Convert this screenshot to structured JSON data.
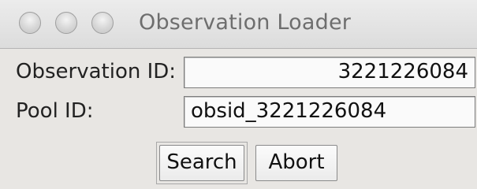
{
  "window": {
    "title": "Observation Loader"
  },
  "form": {
    "observation_id": {
      "label": "Observation ID:",
      "value": "3221226084"
    },
    "pool_id": {
      "label": "Pool ID:",
      "value": "obsid_3221226084"
    }
  },
  "buttons": {
    "search_label": "Search",
    "abort_label": "Abort"
  },
  "icons": {
    "close": "close-window-icon",
    "minimize": "minimize-window-icon",
    "zoom": "zoom-window-icon"
  }
}
